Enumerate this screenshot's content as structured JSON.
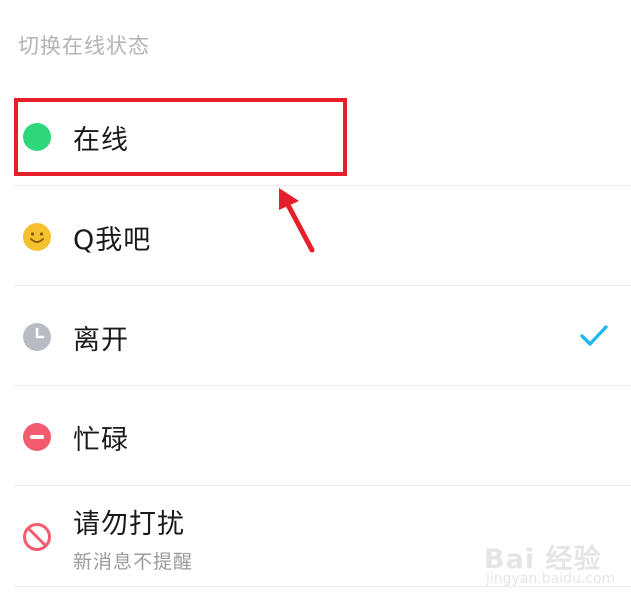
{
  "section": {
    "title": "切换在线状态"
  },
  "status_options": [
    {
      "label": "在线",
      "icon": "online-green-dot-icon",
      "color": "#2dd77a",
      "selected": false
    },
    {
      "label": "Q我吧",
      "icon": "smiley-face-icon",
      "color": "#f6c12e",
      "selected": false
    },
    {
      "label": "离开",
      "icon": "clock-icon",
      "color": "#b8bac4",
      "selected": true
    },
    {
      "label": "忙碌",
      "icon": "busy-minus-icon",
      "color": "#f35c6e",
      "selected": false
    },
    {
      "label": "请勿打扰",
      "sublabel": "新消息不提醒",
      "icon": "no-entry-icon",
      "color": "#f35c6e",
      "selected": false
    }
  ],
  "selected_check_color": "#1fb8f0",
  "annotation": {
    "box_color": "#e5202a"
  },
  "watermark": {
    "brand": "Bai 经验",
    "url": "jingyan.baidu.com"
  }
}
